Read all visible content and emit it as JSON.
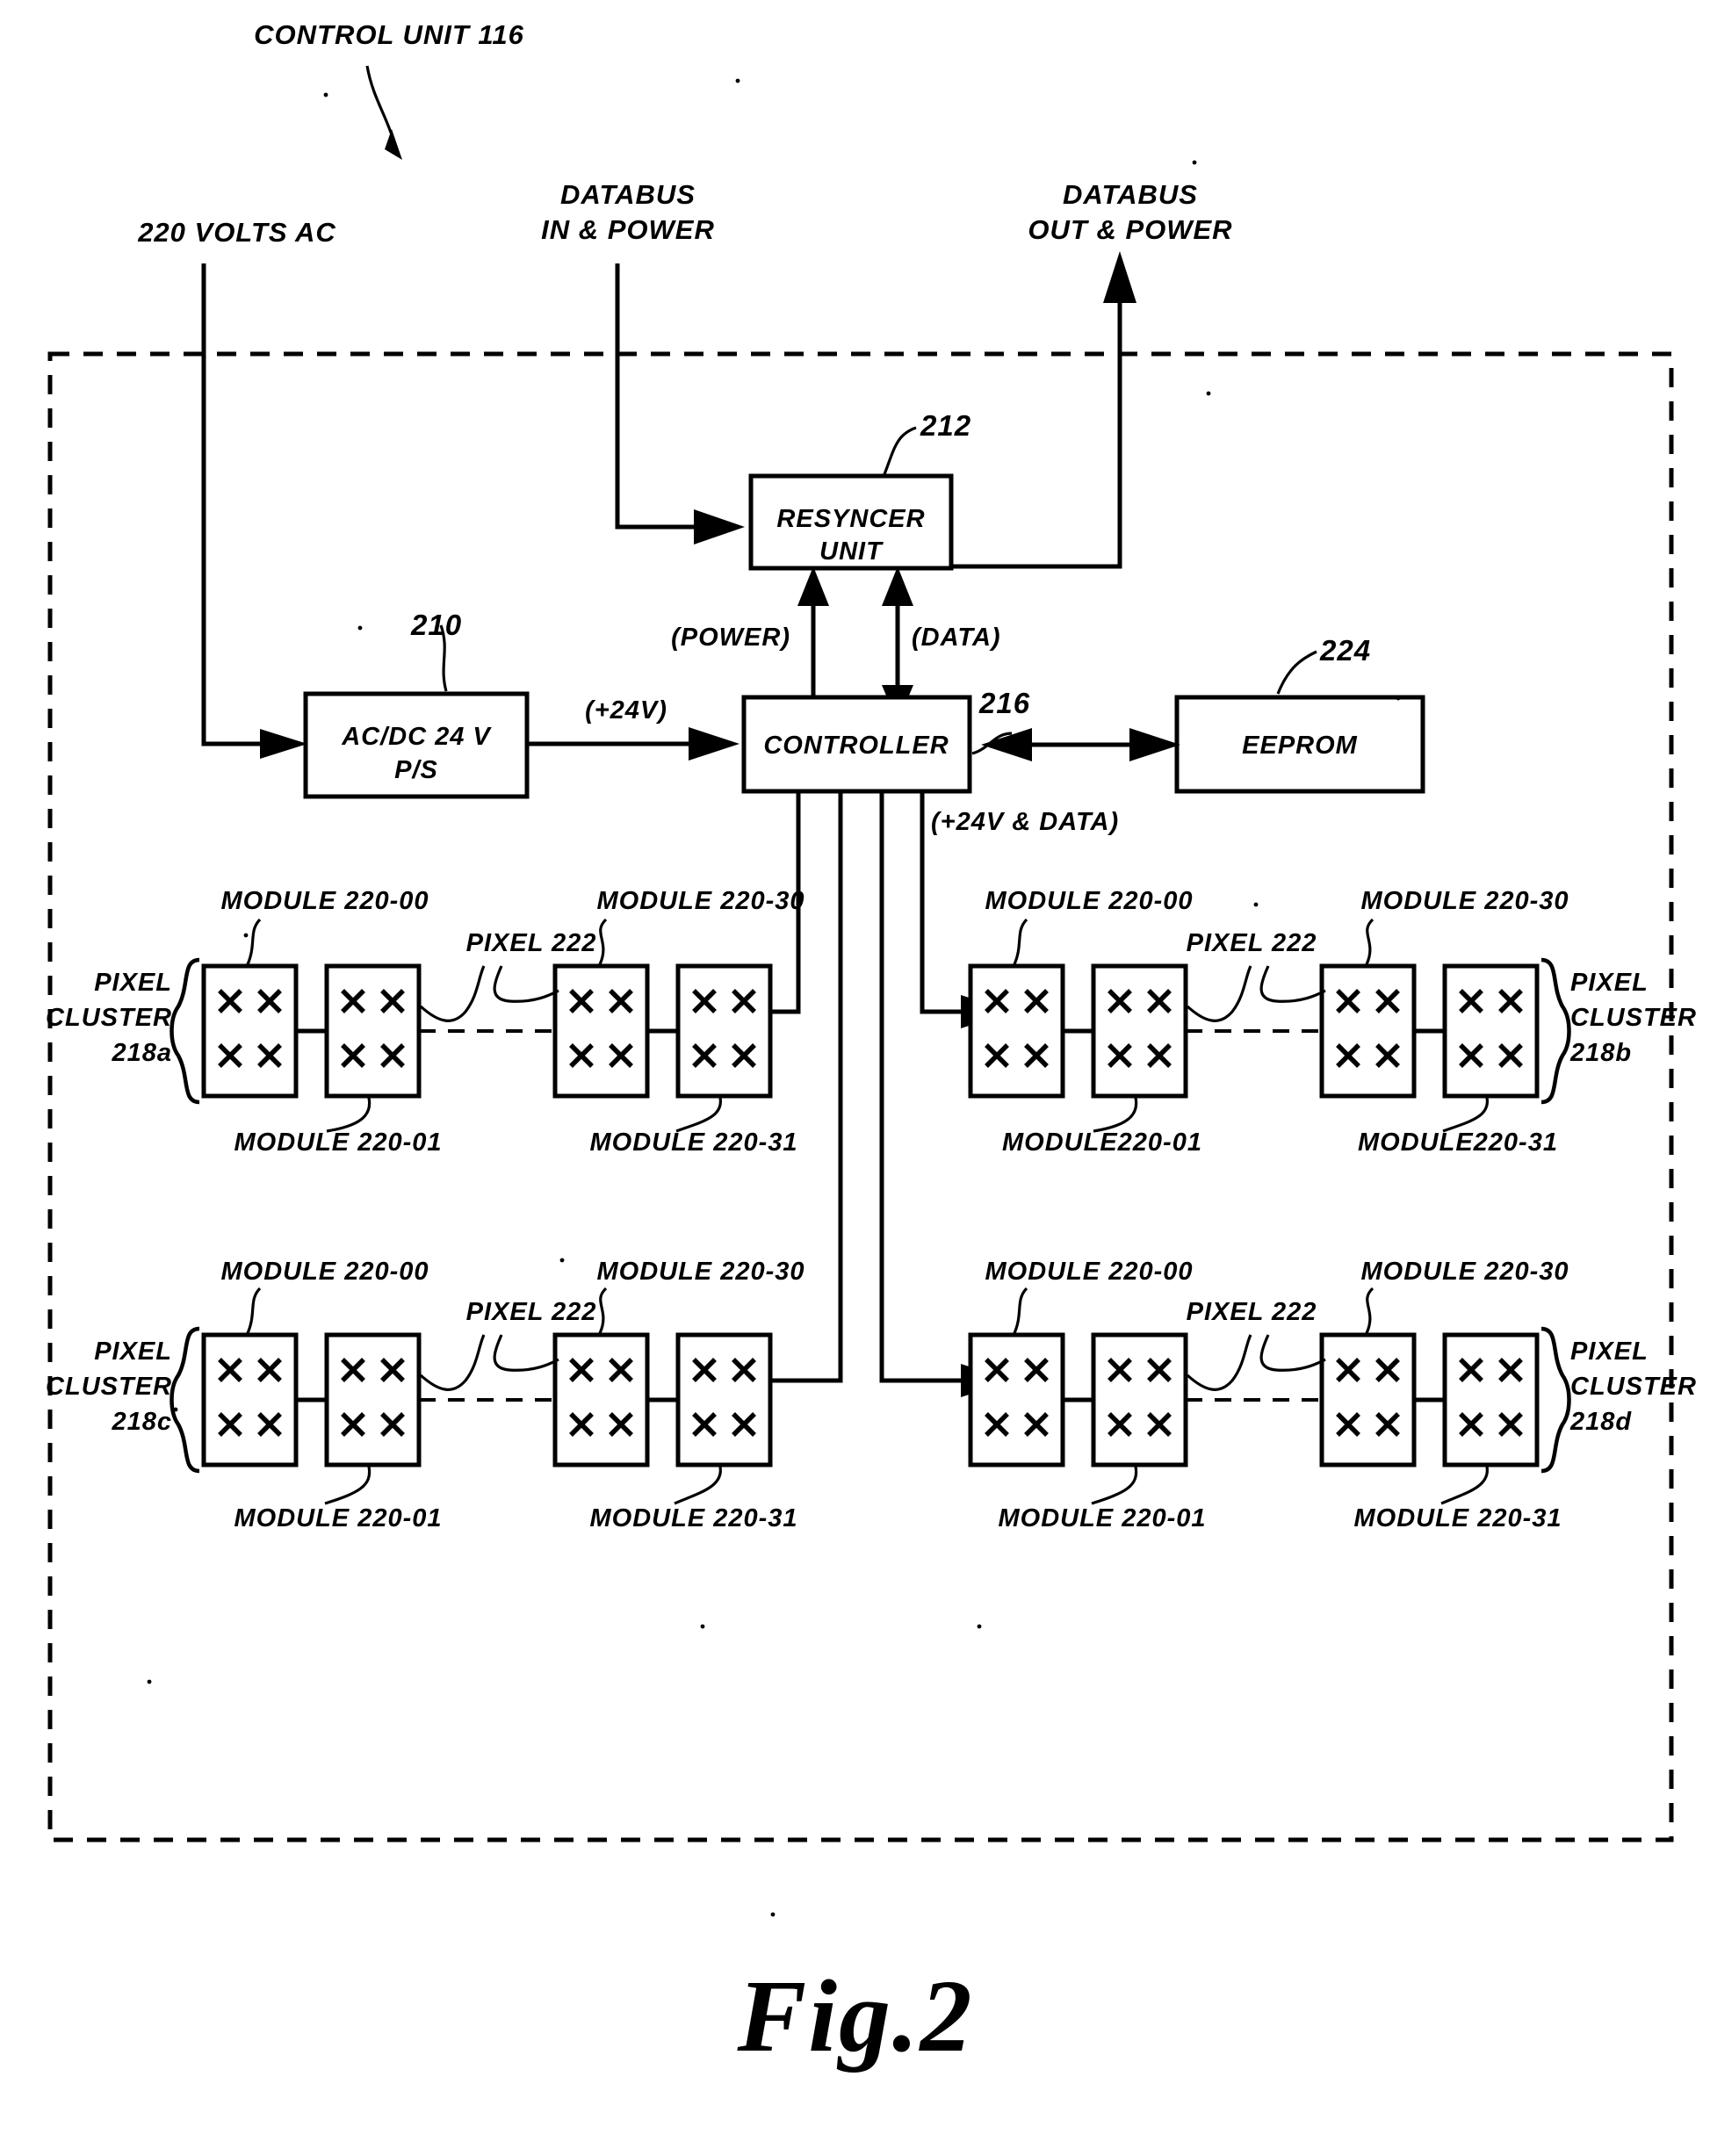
{
  "figure": {
    "caption": "Fig.2",
    "title": "CONTROL UNIT 116"
  },
  "external_labels": {
    "power_in": "220 VOLTS AC",
    "databus_in_l1": "DATABUS",
    "databus_in_l2": "IN & POWER",
    "databus_out_l1": "DATABUS",
    "databus_out_l2": "OUT & POWER"
  },
  "blocks": {
    "resyncer": {
      "line1": "RESYNCER",
      "line2": "UNIT",
      "ref": "212"
    },
    "psu": {
      "line1": "AC/DC 24 V",
      "line2": "P/S",
      "ref": "210"
    },
    "controller": {
      "label": "CONTROLLER",
      "ref": "216"
    },
    "eeprom": {
      "label": "EEPROM",
      "ref": "224"
    }
  },
  "signal_labels": {
    "power": "(POWER)",
    "data": "(DATA)",
    "plus24v": "(+24V)",
    "plus24v_data": "(+24V & DATA)"
  },
  "clusters": [
    {
      "id": "218a",
      "cluster_l1": "PIXEL",
      "cluster_l2": "CLUSTER",
      "cluster_l3": "218a",
      "brace_side": "right",
      "top_left": "MODULE 220-00",
      "top_right": "MODULE 220-30",
      "bottom_left": "MODULE 220-01",
      "bottom_right": "MODULE 220-31",
      "pixel_label": "PIXEL 222"
    },
    {
      "id": "218b",
      "cluster_l1": "PIXEL",
      "cluster_l2": "CLUSTER",
      "cluster_l3": "218b",
      "brace_side": "left",
      "top_left": "MODULE 220-00",
      "top_right": "MODULE 220-30",
      "bottom_left": "MODULE220-01",
      "bottom_right": "MODULE220-31",
      "pixel_label": "PIXEL 222"
    },
    {
      "id": "218c",
      "cluster_l1": "PIXEL",
      "cluster_l2": "CLUSTER",
      "cluster_l3": "218c",
      "brace_side": "right",
      "top_left": "MODULE 220-00",
      "top_right": "MODULE 220-30",
      "bottom_left": "MODULE 220-01",
      "bottom_right": "MODULE 220-31",
      "pixel_label": "PIXEL 222"
    },
    {
      "id": "218d",
      "cluster_l1": "PIXEL",
      "cluster_l2": "CLUSTER",
      "cluster_l3": "218d",
      "brace_side": "left",
      "top_left": "MODULE 220-00",
      "top_right": "MODULE 220-30",
      "bottom_left": "MODULE 220-01",
      "bottom_right": "MODULE 220-31",
      "pixel_label": "PIXEL 222"
    }
  ],
  "colors": {
    "ink": "#000000",
    "paper": "#ffffff"
  }
}
